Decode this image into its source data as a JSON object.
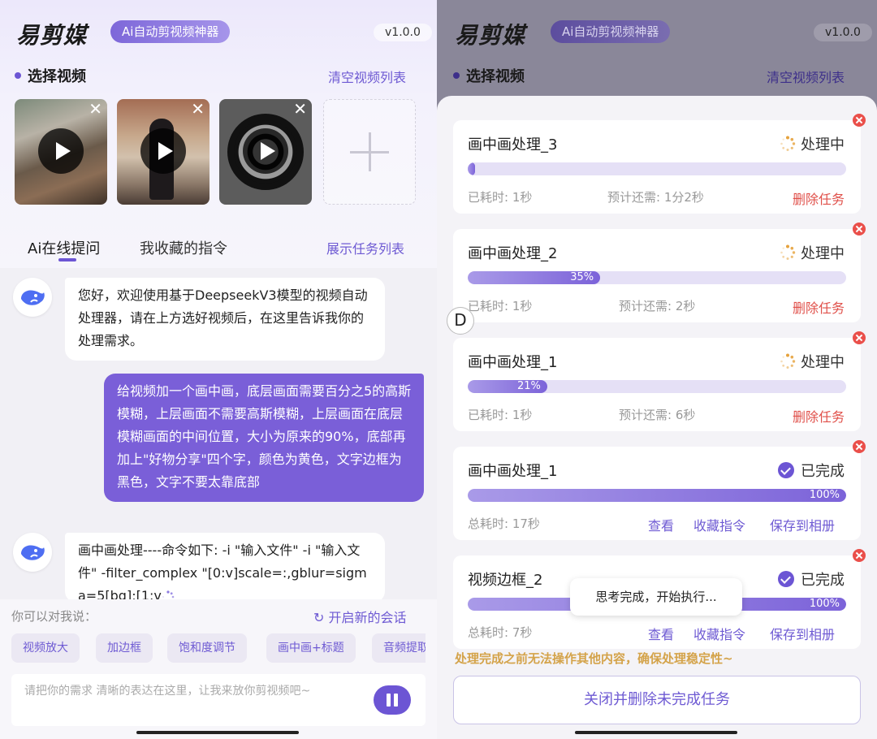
{
  "app": {
    "logo": "易剪媒",
    "tagline": "Ai自动剪视频神器",
    "version": "v1.0.0"
  },
  "video_section": {
    "title": "选择视频",
    "clear_label": "清空视频列表",
    "close_glyph": "✕"
  },
  "tabs": {
    "ai_ask": "Ai在线提问",
    "favorites": "我收藏的指令",
    "show_tasks": "展示任务列表"
  },
  "chat": {
    "welcome": "您好，欢迎使用基于DeepseekV3模型的视频自动处理器，请在上方选好视频后，在这里告诉我你的处理需求。",
    "user_message": "给视频加一个画中画，底层画面需要百分之5的高斯模糊，上层画面不需要高斯模糊，上层画面在底层模糊画面的中间位置，大小为原来的90%，底部再加上\"好物分享\"四个字，颜色为黄色，文字边框为黑色，文字不要太靠底部",
    "ai_response": "画中画处理----命令如下: -i \"输入文件\" -i \"输入文件\" -filter_complex \"[0:v]scale=:,gblur=sigma=5[bg];[1:v"
  },
  "suggest": {
    "hint": "你可以对我说：",
    "new_session": "开启新的会话",
    "refresh_glyph": "↻",
    "chips": [
      "视频放大",
      "加边框",
      "饱和度调节",
      "画中画+标题",
      "音频提取"
    ]
  },
  "input": {
    "placeholder": "请把你的需求 清晰的表达在这里，让我来放你剪视频吧~"
  },
  "tasks": {
    "items": [
      {
        "title": "画中画处理_3",
        "status": "处理中",
        "state": "processing",
        "progress": 2,
        "progress_label": "",
        "elapsed": "已耗时: 1秒",
        "remaining": "预计还需: 1分2秒",
        "delete": "删除任务"
      },
      {
        "title": "画中画处理_2",
        "status": "处理中",
        "state": "processing",
        "progress": 35,
        "progress_label": "35%",
        "elapsed": "已耗时: 1秒",
        "remaining": "预计还需: 2秒",
        "delete": "删除任务"
      },
      {
        "title": "画中画处理_1",
        "status": "处理中",
        "state": "processing",
        "progress": 21,
        "progress_label": "21%",
        "elapsed": "已耗时: 1秒",
        "remaining": "预计还需: 6秒",
        "delete": "删除任务"
      },
      {
        "title": "画中画处理_1",
        "status": "已完成",
        "state": "done",
        "progress": 100,
        "progress_label": "100%",
        "elapsed": "总耗时: 17秒",
        "view": "查看",
        "favorite": "收藏指令",
        "save": "保存到相册"
      },
      {
        "title": "视频边框_2",
        "status": "已完成",
        "state": "done",
        "progress": 100,
        "progress_label": "100%",
        "elapsed": "总耗时: 7秒",
        "view": "查看",
        "favorite": "收藏指令",
        "save": "保存到相册"
      }
    ],
    "floating_letter": "D",
    "toast": "思考完成，开始执行...",
    "warning": "处理完成之前无法操作其他内容，确保处理稳定性~",
    "close_all": "关闭并删除未完成任务"
  },
  "colors": {
    "accent": "#6c55d4",
    "accent_light": "#a99ae8",
    "delete_red": "#e0504a",
    "warning": "#d4a34a"
  },
  "icons": [
    "play-icon",
    "close-icon",
    "plus-icon",
    "whale-avatar-icon",
    "refresh-icon",
    "pause-icon",
    "spinner-icon",
    "check-circle-icon",
    "close-circle-icon"
  ]
}
